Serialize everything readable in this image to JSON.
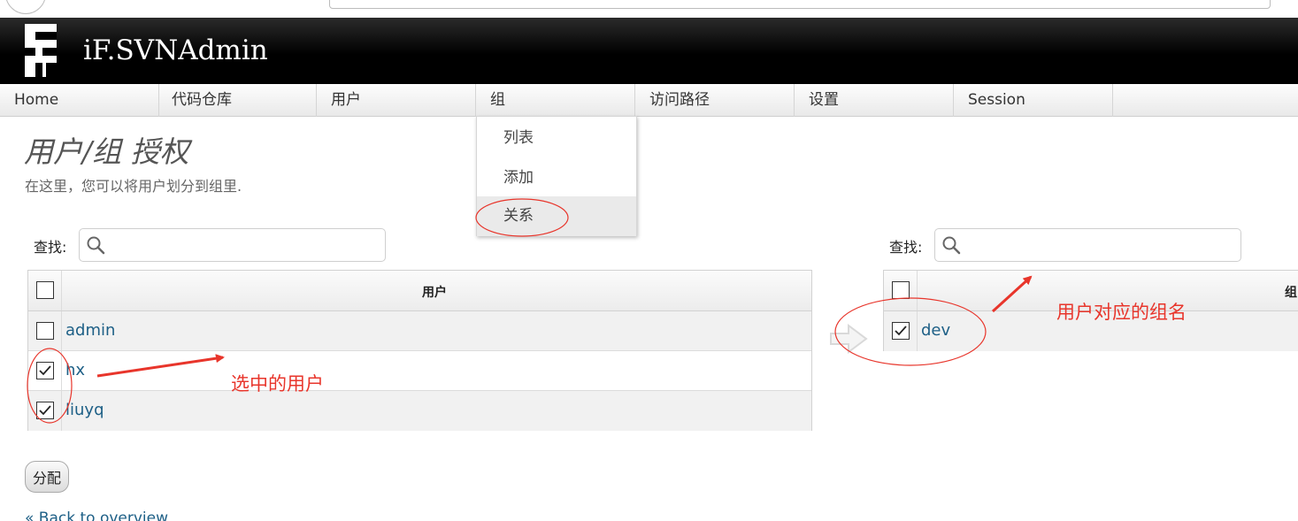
{
  "header": {
    "app_title": "iF.SVNAdmin"
  },
  "nav": {
    "items": [
      {
        "label": "Home"
      },
      {
        "label": "代码仓库"
      },
      {
        "label": "用户"
      },
      {
        "label": "组"
      },
      {
        "label": "访问路径"
      },
      {
        "label": "设置"
      },
      {
        "label": "Session"
      }
    ]
  },
  "dropdown": {
    "items": [
      {
        "label": "列表"
      },
      {
        "label": "添加"
      },
      {
        "label": "关系",
        "active": true
      }
    ]
  },
  "page": {
    "title": "用户/组 授权",
    "subtitle": "在这里，您可以将用户划分到组里."
  },
  "left_panel": {
    "search_label": "查找:",
    "column_header": "用户",
    "rows": [
      {
        "name": "admin",
        "checked": false
      },
      {
        "name": "hx",
        "checked": true
      },
      {
        "name": "liuyq",
        "checked": true
      }
    ]
  },
  "right_panel": {
    "search_label": "查找:",
    "column_header": "组",
    "rows": [
      {
        "name": "dev",
        "checked": true
      }
    ]
  },
  "actions": {
    "assign_label": "分配",
    "back_label": "« Back to overview"
  },
  "annotations": {
    "selected_users": "选中的用户",
    "group_name": "用户对应的组名"
  },
  "colors": {
    "annotation": "#e8352b",
    "link": "#1d5f86"
  }
}
